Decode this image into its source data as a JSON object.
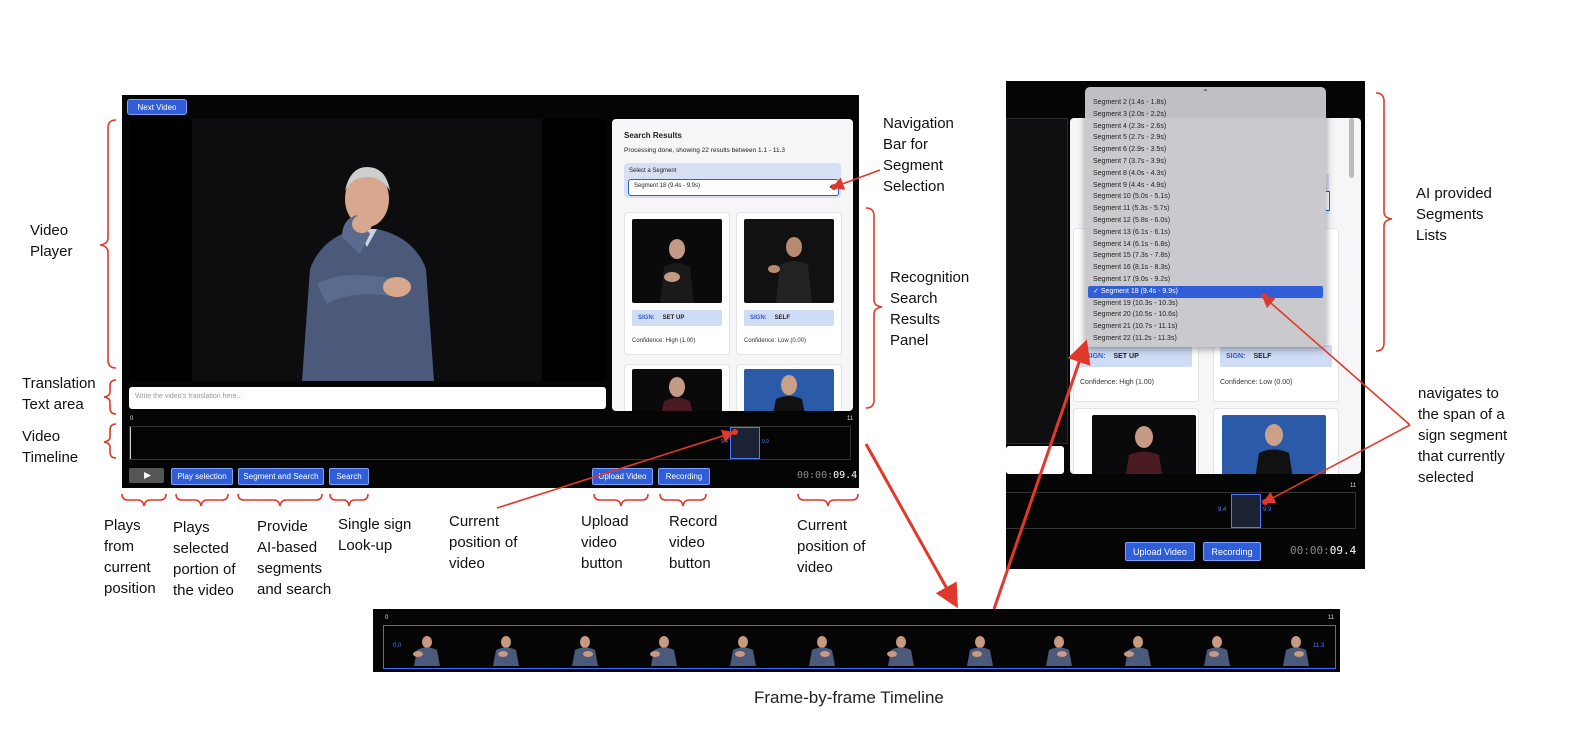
{
  "player": {
    "next_video": "Next Video",
    "translation_placeholder": "Write the video's translation here...",
    "timeline_start": "0",
    "timeline_end": "11",
    "marker_start": "9.4",
    "marker_end": "9.9",
    "controls": {
      "play_icon": "play-icon",
      "play_selection": "Play selection",
      "segment_search": "Segment and Search",
      "search": "Search",
      "upload": "Upload Video",
      "recording": "Recording"
    },
    "time_prefix": "00:00:",
    "time_value": "09.4"
  },
  "results": {
    "title": "Search Results",
    "status": "Processing done, showing 22 results between 1.1 - 11.3",
    "select_label": "Select a Segment",
    "selected_segment": "Segment 18 (9.4s - 9.9s)",
    "cards": [
      {
        "sign_key": "SIGN:",
        "sign": "SET UP",
        "confidence": "Confidence: High (1.00)"
      },
      {
        "sign_key": "SIGN:",
        "sign": "SELF",
        "confidence": "Confidence: Low (0.00)"
      }
    ]
  },
  "dropdown": {
    "items": [
      "Segment 2 (1.4s - 1.8s)",
      "Segment 3 (2.0s - 2.2s)",
      "Segment 4 (2.3s - 2.6s)",
      "Segment 5 (2.7s - 2.9s)",
      "Segment 6 (2.9s - 3.5s)",
      "Segment 7 (3.7s - 3.9s)",
      "Segment 8 (4.0s - 4.3s)",
      "Segment 9 (4.4s - 4.9s)",
      "Segment 10 (5.0s - 5.1s)",
      "Segment 11 (5.3s - 5.7s)",
      "Segment 12 (5.8s - 6.0s)",
      "Segment 13 (6.1s - 6.1s)",
      "Segment 14 (6.1s - 6.8s)",
      "Segment 15 (7.3s - 7.8s)",
      "Segment 16 (8.1s - 8.3s)",
      "Segment 17 (9.0s - 9.2s)",
      "Segment 18 (9.4s - 9.9s)",
      "Segment 19 (10.3s - 10.3s)",
      "Segment 20 (10.5s - 10.6s)",
      "Segment 21 (10.7s - 11.1s)",
      "Segment 22 (11.2s - 11.3s)"
    ],
    "selected_index": 16,
    "checkmark": "✓",
    "up_chevron": "⌃",
    "right_cards": [
      {
        "sign_key": "SIGN:",
        "sign": "SET UP",
        "confidence": "Confidence: High (1.00)"
      },
      {
        "sign_key": "SIGN:",
        "sign": "SELF",
        "confidence": "Confidence: Low (0.00)"
      }
    ],
    "timeline_end": "11",
    "marker_start": "9.4",
    "marker_end": "9.9",
    "upload": "Upload Video",
    "recording": "Recording",
    "time_prefix": "00:00:",
    "time_value": "09.4"
  },
  "filmstrip": {
    "start": "0",
    "end": "11",
    "left_value": "0.0",
    "right_value": "11.3",
    "caption": "Frame-by-frame Timeline"
  },
  "annotations": {
    "video_player": [
      "Video",
      "Player"
    ],
    "translation": [
      "Translation",
      "Text area"
    ],
    "timeline": [
      "Video",
      "Timeline"
    ],
    "nav_bar": [
      "Navigation",
      "Bar for",
      "Segment",
      "Selection"
    ],
    "recognition": [
      "Recognition",
      "Search",
      "Results",
      "Panel"
    ],
    "ai_lists": [
      "AI provided",
      "Segments",
      "Lists"
    ],
    "navigates": [
      "navigates to",
      "the span of a",
      "sign segment",
      "that currently",
      "selected"
    ],
    "plays_current": [
      "Plays",
      "from",
      "current",
      "position"
    ],
    "plays_selected": [
      "Plays",
      "selected",
      "portion of",
      "the video"
    ],
    "provide_ai": [
      "Provide",
      "AI-based",
      "segments",
      "and search"
    ],
    "single_sign": [
      "Single sign",
      "Look-up"
    ],
    "current_pos_1": [
      "Current",
      "position of",
      "video"
    ],
    "upload": [
      "Upload",
      "video",
      "button"
    ],
    "record": [
      "Record",
      "video",
      "button"
    ],
    "current_pos_2": [
      "Current",
      "position of",
      "video"
    ]
  },
  "colors": {
    "accent": "#2f5ed8",
    "arrow": "#e0392b",
    "brace": "#e0392b",
    "player_bg": "#050505",
    "panel_bg": "#f6f6f8",
    "sign_bar": "#cfdcf6"
  }
}
